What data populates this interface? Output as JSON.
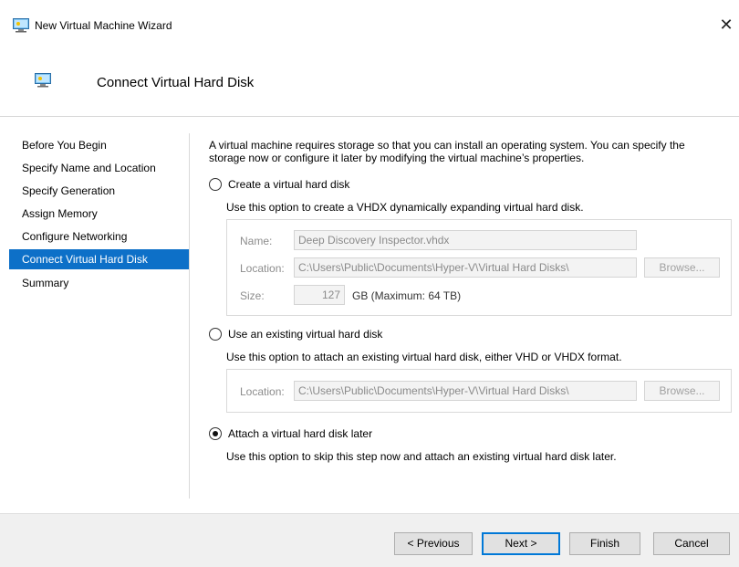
{
  "window": {
    "title": "New Virtual Machine Wizard",
    "close_glyph": "✕"
  },
  "header": {
    "title": "Connect Virtual Hard Disk"
  },
  "sidebar": {
    "items": [
      {
        "label": "Before You Begin"
      },
      {
        "label": "Specify Name and Location"
      },
      {
        "label": "Specify Generation"
      },
      {
        "label": "Assign Memory"
      },
      {
        "label": "Configure Networking"
      },
      {
        "label": "Connect Virtual Hard Disk",
        "active": true
      },
      {
        "label": "Summary"
      }
    ]
  },
  "content": {
    "intro": "A virtual machine requires storage so that you can install an operating system. You can specify the storage now or configure it later by modifying the virtual machine’s properties.",
    "option_create": {
      "label": "Create a virtual hard disk",
      "description": "Use this option to create a VHDX dynamically expanding virtual hard disk.",
      "selected": false,
      "name_label": "Name:",
      "name_value": "Deep Discovery Inspector.vhdx",
      "location_label": "Location:",
      "location_value": "C:\\Users\\Public\\Documents\\Hyper-V\\Virtual Hard Disks\\",
      "browse_label": "Browse...",
      "size_label": "Size:",
      "size_value": "127",
      "size_unit": "GB (Maximum: 64 TB)"
    },
    "option_existing": {
      "label": "Use an existing virtual hard disk",
      "description": "Use this option to attach an existing virtual hard disk, either VHD or VHDX format.",
      "selected": false,
      "location_label": "Location:",
      "location_value": "C:\\Users\\Public\\Documents\\Hyper-V\\Virtual Hard Disks\\",
      "browse_label": "Browse..."
    },
    "option_later": {
      "label": "Attach a virtual hard disk later",
      "description": "Use this option to skip this step now and attach an existing virtual hard disk later.",
      "selected": true
    }
  },
  "footer": {
    "previous_label": "< Previous",
    "next_label": "Next >",
    "finish_label": "Finish",
    "cancel_label": "Cancel"
  },
  "colors": {
    "accent": "#0d70c8",
    "button_focus": "#0078d7"
  },
  "icons": {
    "window": "hyper-v-vm-icon",
    "header": "hyper-v-vm-icon",
    "close": "close-icon"
  }
}
